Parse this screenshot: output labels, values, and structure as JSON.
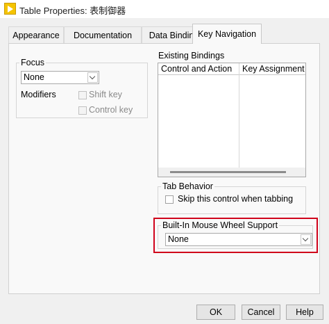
{
  "window": {
    "title": "Table Properties: 表制御器"
  },
  "tabs": [
    {
      "label": "Appearance"
    },
    {
      "label": "Documentation"
    },
    {
      "label": "Data Binding"
    },
    {
      "label": "Key Navigation",
      "active": true
    }
  ],
  "focus": {
    "legend": "Focus",
    "selected": "None",
    "modifiers_label": "Modifiers",
    "shift_key": {
      "label": "Shift key",
      "checked": false,
      "enabled": false
    },
    "control_key": {
      "label": "Control key",
      "checked": false,
      "enabled": false
    }
  },
  "existing_bindings": {
    "label": "Existing Bindings",
    "columns": [
      "Control and Action",
      "Key Assignment"
    ],
    "rows": []
  },
  "tab_behavior": {
    "legend": "Tab Behavior",
    "skip": {
      "label": "Skip this control when tabbing",
      "checked": false
    }
  },
  "mouse_wheel": {
    "legend": "Built-In Mouse Wheel Support",
    "selected": "None"
  },
  "footer": {
    "ok": "OK",
    "cancel": "Cancel",
    "help": "Help"
  },
  "colors": {
    "highlight": "#d0021b",
    "app_icon": "#f5c400"
  }
}
